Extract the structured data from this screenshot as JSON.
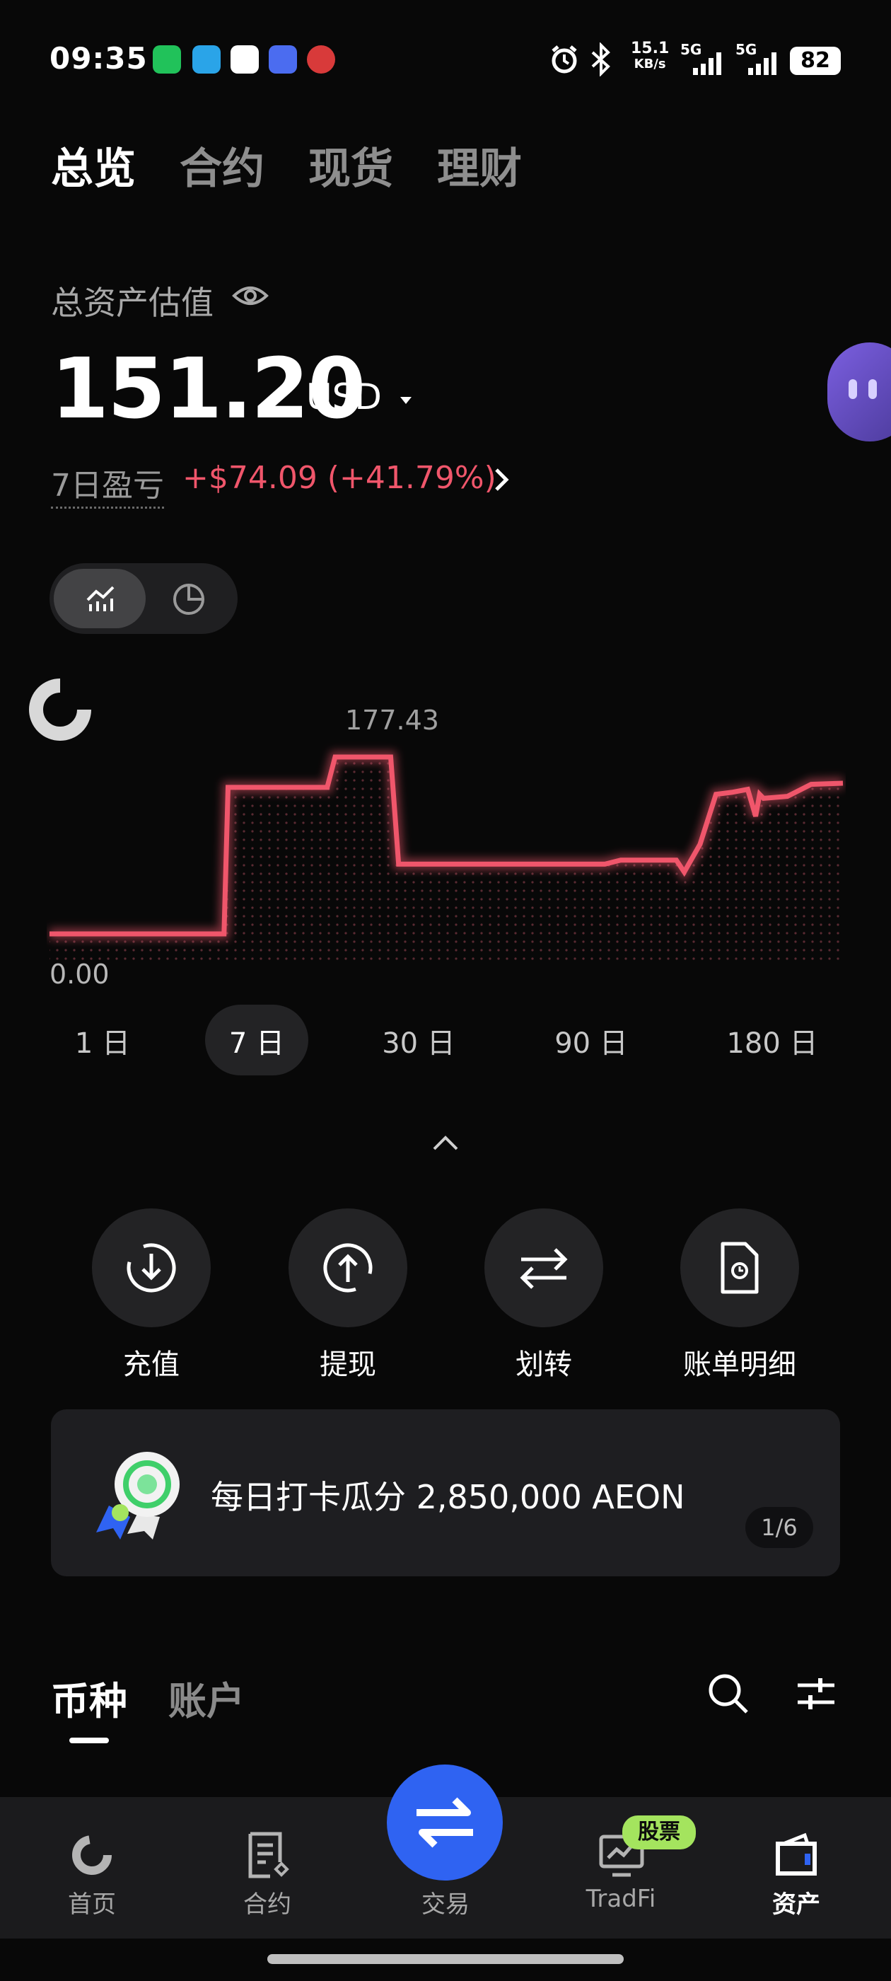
{
  "status_bar": {
    "time": "09:35",
    "net_speed": "15.1",
    "net_unit": "KB/s",
    "signal1": "5G",
    "signal2": "5G",
    "battery": "82"
  },
  "top_tabs": [
    "总览",
    "合约",
    "现货",
    "理财"
  ],
  "asset": {
    "label": "总资产估值",
    "value": "151.20",
    "currency": "USD",
    "pnl_label": "7日盈亏",
    "pnl_value": "+$74.09 (+41.79%)"
  },
  "chart_data": {
    "type": "line",
    "max_label": "177.43",
    "min_label": "0.00",
    "x": [
      0,
      0.22,
      0.225,
      0.35,
      0.36,
      0.43,
      0.44,
      0.58,
      0.7,
      0.72,
      0.79,
      0.8,
      0.82,
      0.84,
      0.86,
      0.88,
      0.89,
      0.895,
      0.9,
      0.93,
      0.96,
      1.0
    ],
    "y": [
      0,
      0,
      147,
      147,
      177.43,
      177.43,
      70,
      70,
      70,
      74,
      74,
      62,
      90,
      140,
      142,
      145,
      118,
      140,
      136,
      138,
      150,
      151.2
    ],
    "ylim": [
      0,
      177.43
    ],
    "color": "#f0566b"
  },
  "ranges": [
    "1 日",
    "7 日",
    "30 日",
    "90 日",
    "180 日"
  ],
  "active_range": "7 日",
  "actions": [
    {
      "label": "充值",
      "icon": "deposit-icon"
    },
    {
      "label": "提现",
      "icon": "withdraw-icon"
    },
    {
      "label": "划转",
      "icon": "transfer-icon"
    },
    {
      "label": "账单明细",
      "icon": "bill-icon"
    }
  ],
  "banner": {
    "text": "每日打卡瓜分 2,850,000 AEON",
    "page": "1/6"
  },
  "list_tabs": [
    "币种",
    "账户"
  ],
  "bottom_nav": [
    {
      "label": "首页",
      "icon": "home-icon"
    },
    {
      "label": "合约",
      "icon": "contract-icon"
    },
    {
      "label": "交易",
      "icon": "trade-icon"
    },
    {
      "label": "TradFi",
      "icon": "tradfi-icon"
    },
    {
      "label": "资产",
      "icon": "wallet-icon"
    }
  ],
  "stock_badge": "股票",
  "colors": {
    "accent_red": "#f0566b",
    "trade_blue": "#2f63f2",
    "badge_green": "#a4e45e"
  }
}
